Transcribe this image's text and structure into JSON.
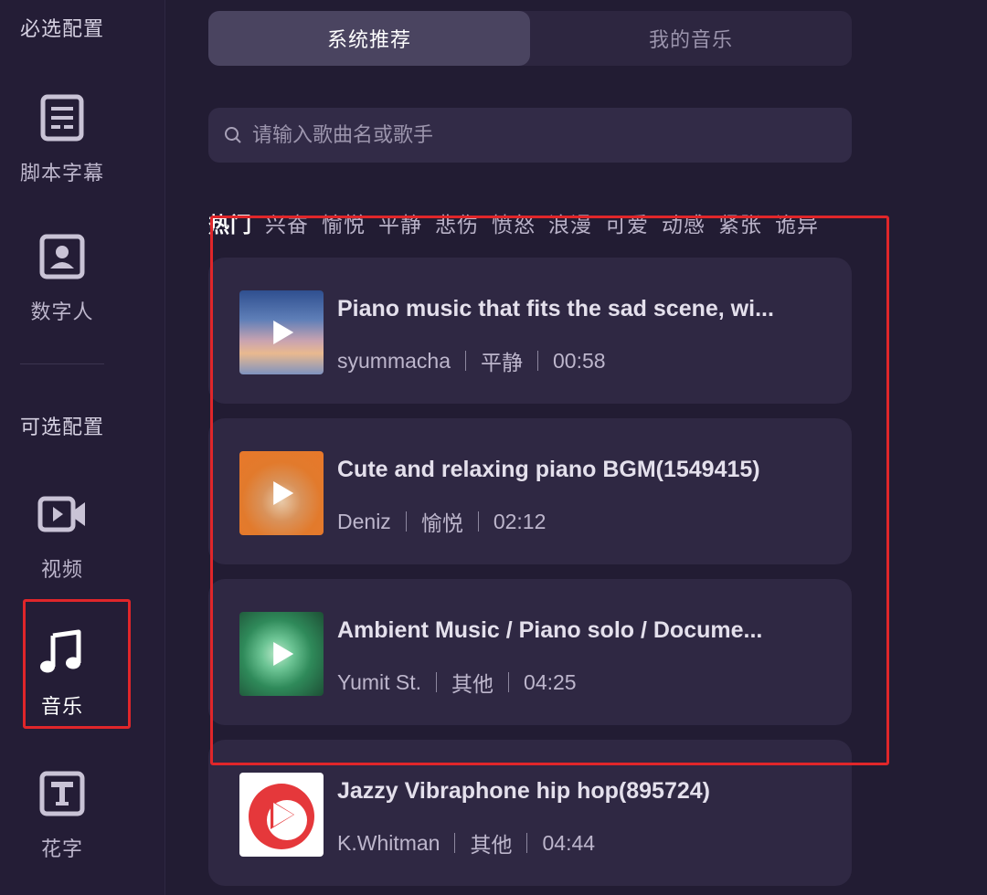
{
  "sidebar": {
    "required_title": "必选配置",
    "optional_title": "可选配置",
    "items": [
      {
        "label": "脚本字幕",
        "icon": "script-subtitle-icon"
      },
      {
        "label": "数字人",
        "icon": "digital-human-icon"
      },
      {
        "label": "视频",
        "icon": "video-camera-icon"
      },
      {
        "label": "音乐",
        "icon": "music-note-icon",
        "active": true
      },
      {
        "label": "花字",
        "icon": "text-style-icon"
      }
    ]
  },
  "tabs": [
    {
      "label": "系统推荐",
      "active": true
    },
    {
      "label": "我的音乐",
      "active": false
    }
  ],
  "search": {
    "placeholder": "请输入歌曲名或歌手"
  },
  "categories": [
    "热门",
    "兴奋",
    "愉悦",
    "平静",
    "悲伤",
    "愤怒",
    "浪漫",
    "可爱",
    "动感",
    "紧张",
    "诡异"
  ],
  "active_category": "热门",
  "songs": [
    {
      "title": "Piano music that fits the sad scene, wi...",
      "artist": "syummacha",
      "mood": "平静",
      "duration": "00:58",
      "cover": "sky-sunset"
    },
    {
      "title": "Cute and relaxing piano BGM(1549415)",
      "artist": "Deniz",
      "mood": "愉悦",
      "duration": "02:12",
      "cover": "dog-orange"
    },
    {
      "title": "Ambient Music / Piano solo / Docume...",
      "artist": "Yumit St.",
      "mood": "其他",
      "duration": "04:25",
      "cover": "green-leaves"
    },
    {
      "title": "Jazzy Vibraphone hip hop(895724)",
      "artist": "K.Whitman",
      "mood": "其他",
      "duration": "04:44",
      "cover": "red-logo"
    }
  ],
  "colors": {
    "accent_red": "#e0262a",
    "background": "#221c33",
    "card": "#2f2843"
  }
}
